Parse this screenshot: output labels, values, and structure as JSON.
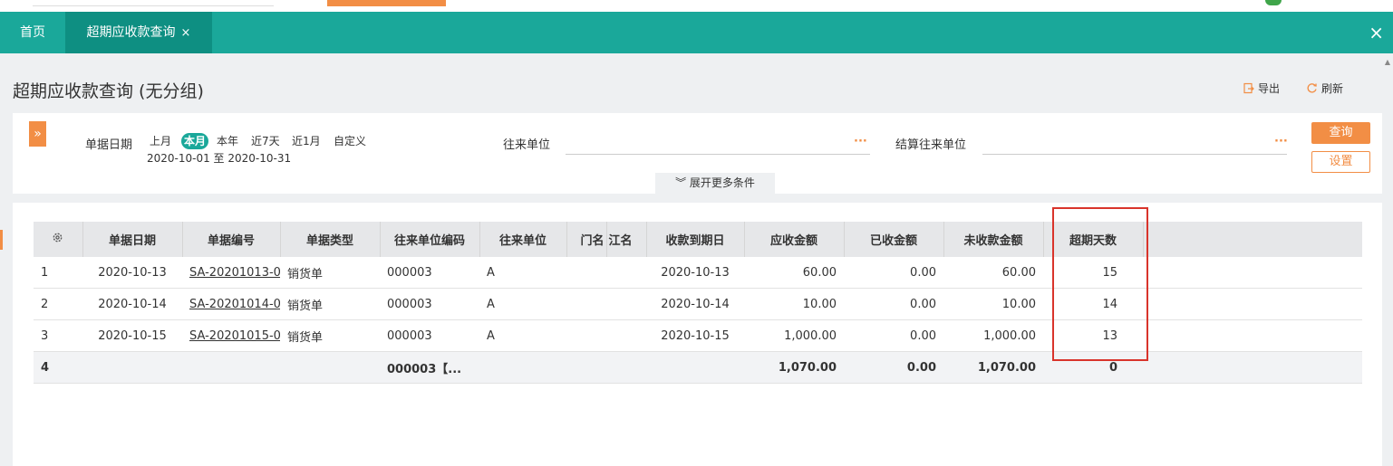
{
  "tabs": {
    "home": "首页",
    "active": "超期应收款查询",
    "active_close": "×",
    "close_all": "×"
  },
  "page": {
    "title": "超期应收款查询 (无分组)"
  },
  "toolbar": {
    "export_label": "导出",
    "refresh_label": "刷新",
    "export_icon": "export-icon",
    "refresh_icon": "refresh-icon"
  },
  "filter": {
    "expand_glyph": "»",
    "date_label": "单据日期",
    "periods": [
      "上月",
      "本月",
      "本年",
      "近7天",
      "近1月",
      "自定义"
    ],
    "selected_period": "本月",
    "date_range": "2020-10-01 至 2020-10-31",
    "partner_label": "往来单位",
    "settle_partner_label": "结算往来单位",
    "dots": "···",
    "query_button": "查询",
    "settings_button": "设置",
    "more_conditions": "展开更多条件",
    "more_glyph": "︾"
  },
  "table": {
    "columns": [
      "单据日期",
      "单据编号",
      "单据类型",
      "往来单位编码",
      "往来单位",
      "门名",
      "江名",
      "收款到期日",
      "应收金额",
      "已收金额",
      "未收款金额",
      "超期天数"
    ],
    "rows": [
      {
        "no": "1",
        "date": "2020-10-13",
        "code": "SA-20201013-0",
        "type": "销货单",
        "partner_code": "000003",
        "partner": "A",
        "due": "2020-10-13",
        "receivable": "60.00",
        "received": "0.00",
        "unpaid": "60.00",
        "overdue": "15"
      },
      {
        "no": "2",
        "date": "2020-10-14",
        "code": "SA-20201014-0",
        "type": "销货单",
        "partner_code": "000003",
        "partner": "A",
        "due": "2020-10-14",
        "receivable": "10.00",
        "received": "0.00",
        "unpaid": "10.00",
        "overdue": "14"
      },
      {
        "no": "3",
        "date": "2020-10-15",
        "code": "SA-20201015-0",
        "type": "销货单",
        "partner_code": "000003",
        "partner": "A",
        "due": "2020-10-15",
        "receivable": "1,000.00",
        "received": "0.00",
        "unpaid": "1,000.00",
        "overdue": "13"
      }
    ],
    "total": {
      "no": "4",
      "partner_code": "000003【...",
      "receivable": "1,070.00",
      "received": "0.00",
      "unpaid": "1,070.00",
      "overdue": "0"
    }
  },
  "colors": {
    "teal": "#1aa89a",
    "teal_dark": "#0e8f82",
    "orange": "#f28e45",
    "highlight_red": "#d9342b"
  }
}
